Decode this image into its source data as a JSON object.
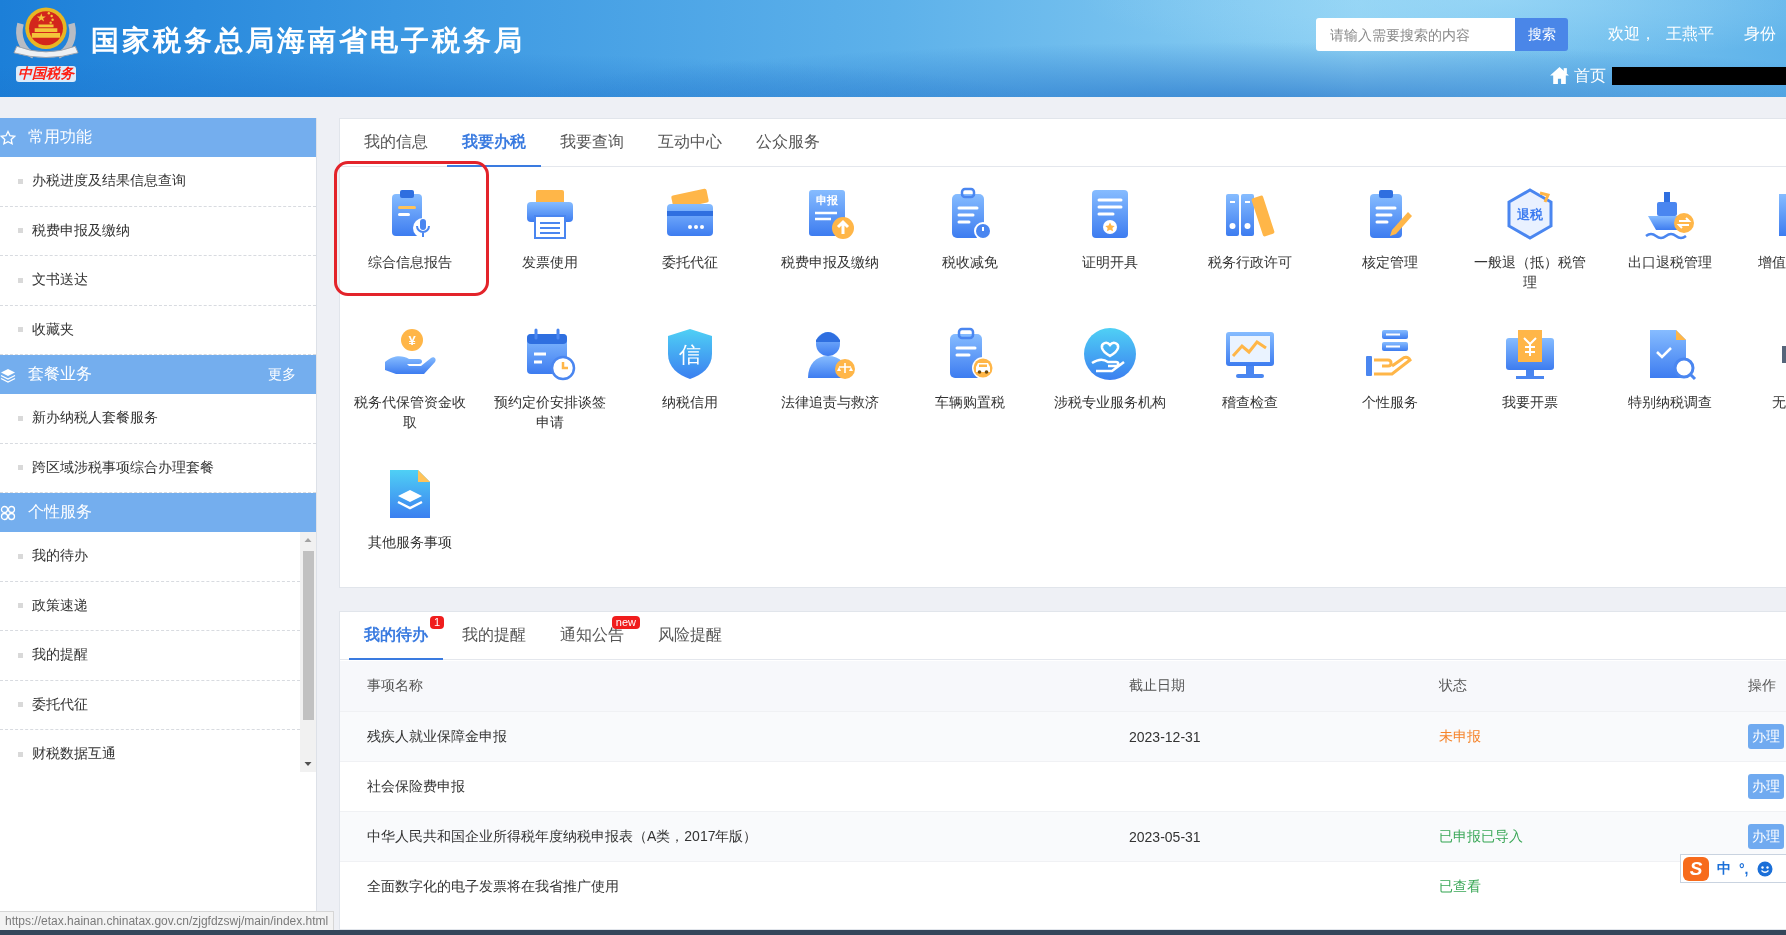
{
  "header": {
    "emblem_caption": "中国税务",
    "title": "国家税务总局海南省电子税务局",
    "search": {
      "placeholder": "请输入需要搜索的内容",
      "button": "搜索"
    },
    "welcome": "欢迎，",
    "user": "王燕平",
    "switch_identity": "身份",
    "home": "首页"
  },
  "sidebar": {
    "sections": [
      {
        "title": "常用功能",
        "scrollable": false,
        "items": [
          "办税进度及结果信息查询",
          "税费申报及缴纳",
          "文书送达",
          "收藏夹"
        ]
      },
      {
        "title": "套餐业务",
        "more": "更多",
        "scrollable": false,
        "items": [
          "新办纳税人套餐服务",
          "跨区域涉税事项综合办理套餐"
        ]
      },
      {
        "title": "个性服务",
        "scrollable": true,
        "items": [
          "我的待办",
          "政策速递",
          "我的提醒",
          "委托代征",
          "财税数据互通"
        ]
      }
    ]
  },
  "main_tabs": [
    {
      "label": "我的信息",
      "selected": false
    },
    {
      "label": "我要办税",
      "selected": true
    },
    {
      "label": "我要查询",
      "selected": false
    },
    {
      "label": "互动中心",
      "selected": false
    },
    {
      "label": "公众服务",
      "selected": false
    }
  ],
  "services": [
    {
      "kind": "full",
      "label": "综合信息报告",
      "highlighted": true
    },
    {
      "kind": "full",
      "label": "发票使用",
      "highlighted": false
    },
    {
      "kind": "full",
      "label": "委托代征",
      "highlighted": false
    },
    {
      "kind": "full",
      "label": "税费申报及缴纳",
      "icon_text": "申报",
      "highlighted": false
    },
    {
      "kind": "full",
      "label": "税收减免",
      "highlighted": false
    },
    {
      "kind": "full",
      "label": "证明开具",
      "highlighted": false
    },
    {
      "kind": "full",
      "label": "税务行政许可",
      "highlighted": false
    },
    {
      "kind": "full",
      "label": "核定管理",
      "highlighted": false
    },
    {
      "kind": "full",
      "label": "一般退（抵）税管理",
      "icon_text": "退税",
      "highlighted": false
    },
    {
      "kind": "full",
      "label": "出口退税管理",
      "highlighted": false
    },
    {
      "kind": "clipped",
      "label": "增值",
      "highlighted": false
    },
    {
      "kind": "full",
      "label": "税务代保管资金收取",
      "icon_text": "¥",
      "highlighted": false
    },
    {
      "kind": "full",
      "label": "预约定价安排谈签申请",
      "highlighted": false
    },
    {
      "kind": "full",
      "label": "纳税信用",
      "icon_text": "信",
      "highlighted": false
    },
    {
      "kind": "full",
      "label": "法律追责与救济",
      "highlighted": false
    },
    {
      "kind": "full",
      "label": "车辆购置税",
      "highlighted": false
    },
    {
      "kind": "full",
      "label": "涉税专业服务机构",
      "highlighted": false
    },
    {
      "kind": "full",
      "label": "稽查检查",
      "highlighted": false
    },
    {
      "kind": "full",
      "label": "个性服务",
      "highlighted": false
    },
    {
      "kind": "full",
      "label": "我要开票",
      "highlighted": false
    },
    {
      "kind": "full",
      "label": "特别纳税调查",
      "highlighted": false
    },
    {
      "kind": "clipped",
      "label": "无",
      "highlighted": false
    },
    {
      "kind": "full",
      "label": "其他服务事项",
      "highlighted": false
    }
  ],
  "task_panel": {
    "tabs": [
      {
        "label": "我的待办",
        "selected": true,
        "badge": "1"
      },
      {
        "label": "我的提醒",
        "selected": false
      },
      {
        "label": "通知公告",
        "selected": false,
        "badge": "new"
      },
      {
        "label": "风险提醒",
        "selected": false
      }
    ],
    "table": {
      "columns": [
        "事项名称",
        "截止日期",
        "状态",
        "操作"
      ],
      "rows": [
        {
          "name": "残疾人就业保障金申报",
          "deadline": "2023-12-31",
          "status": {
            "text": "未申报",
            "color": "#f5832a"
          },
          "action": "办理"
        },
        {
          "name": "社会保险费申报",
          "action": "办理"
        },
        {
          "name": "中华人民共和国企业所得税年度纳税申报表（A类，2017年版）",
          "deadline": "2023-05-31",
          "status": {
            "text": "已申报已导入",
            "color": "#3aa757"
          },
          "action": "办理"
        },
        {
          "name": "全面数字化的电子发票将在我省推广使用",
          "status": {
            "text": "已查看",
            "color": "#3aa757"
          }
        }
      ]
    }
  },
  "ime_toolbar": {
    "logo": "S",
    "mode": "中",
    "punctuation": "°,"
  },
  "status_bar": {
    "url": "https://etax.hainan.chinatax.gov.cn/zjgfdzswj/main/index.html"
  }
}
